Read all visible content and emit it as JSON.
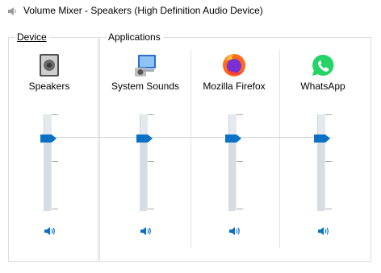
{
  "window": {
    "title": "Volume Mixer - Speakers (High Definition Audio Device)",
    "icon": "speaker-icon"
  },
  "device": {
    "section_label": "Device",
    "channel": {
      "label": "Speakers",
      "icon": "speaker-cabinet-icon",
      "volume_percent": 75
    }
  },
  "applications": {
    "section_label": "Applications",
    "channels": [
      {
        "label": "System Sounds",
        "icon": "system-sounds-icon",
        "volume_percent": 75
      },
      {
        "label": "Mozilla Firefox",
        "icon": "firefox-icon",
        "volume_percent": 75
      },
      {
        "label": "WhatsApp",
        "icon": "whatsapp-icon",
        "volume_percent": 75
      }
    ]
  },
  "mute_icon": "speaker-volume-icon",
  "colors": {
    "accent": "#0a72c6",
    "whatsapp": "#25d366",
    "firefox": "#ff6b1a"
  }
}
